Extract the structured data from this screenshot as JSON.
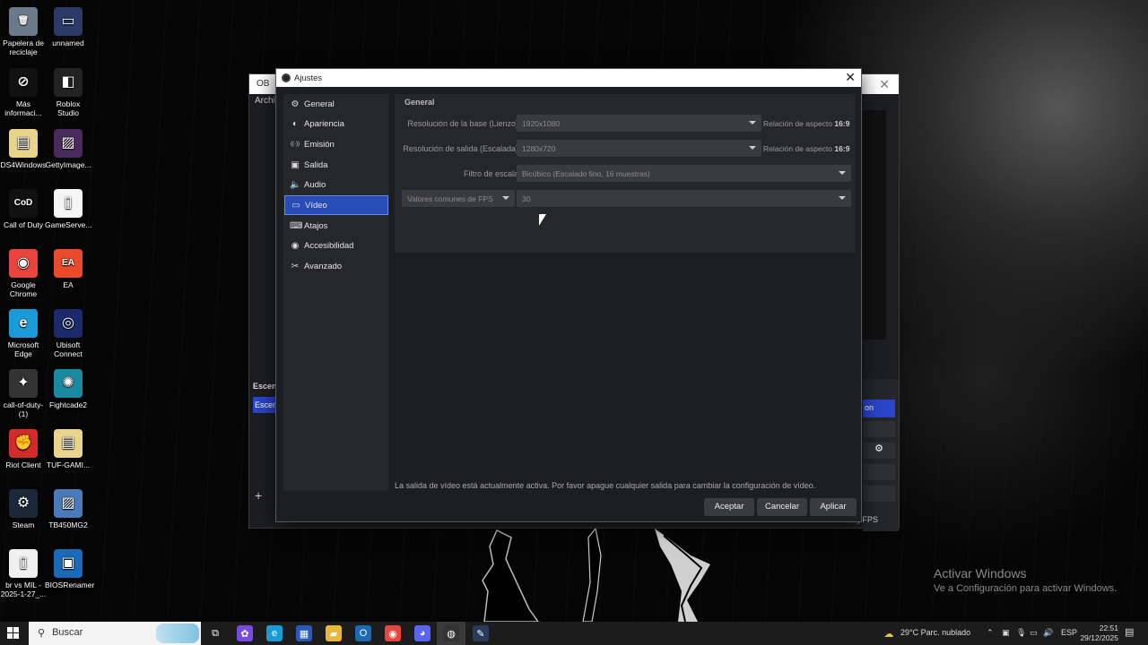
{
  "desktop": {
    "icons": [
      {
        "label": "Papelera de reciclaje",
        "icon": "recycle-bin-icon",
        "color": "#6b7a8a",
        "glyph": "🗑"
      },
      {
        "label": "unnamed",
        "icon": "image-file-icon",
        "color": "#2b3a66",
        "glyph": "▭"
      },
      {
        "label": "Más informaci...",
        "icon": "info-circle-icon",
        "color": "#111111",
        "glyph": "⊘"
      },
      {
        "label": "Roblox Studio",
        "icon": "roblox-studio-icon",
        "color": "#222222",
        "glyph": "◧"
      },
      {
        "label": "DS4Windows",
        "icon": "folder-file-icon",
        "color": "#e8d48a",
        "glyph": "▤"
      },
      {
        "label": "GettyImage...",
        "icon": "image-file-icon",
        "color": "#4a2a5a",
        "glyph": "▨"
      },
      {
        "label": "Call of Duty",
        "icon": "call-of-duty-icon",
        "color": "#111111",
        "glyph": "CoD"
      },
      {
        "label": "GameServe...",
        "icon": "document-file-icon",
        "color": "#f5f5f5",
        "glyph": "▯"
      },
      {
        "label": "Google Chrome",
        "icon": "chrome-icon",
        "color": "#e8453c",
        "glyph": "◉"
      },
      {
        "label": "EA",
        "icon": "ea-icon",
        "color": "#e84a2a",
        "glyph": "EA"
      },
      {
        "label": "Microsoft Edge",
        "icon": "edge-icon",
        "color": "#1a9bd8",
        "glyph": "e"
      },
      {
        "label": "Ubisoft Connect",
        "icon": "ubisoft-icon",
        "color": "#1a2a6a",
        "glyph": "◎"
      },
      {
        "label": "call-of-duty-(1)",
        "icon": "shortcut-icon",
        "color": "#333333",
        "glyph": "✦"
      },
      {
        "label": "Fightcade2",
        "icon": "fightcade-icon",
        "color": "#1a8aa0",
        "glyph": "✺"
      },
      {
        "label": "Riot Client",
        "icon": "riot-client-icon",
        "color": "#d32a2a",
        "glyph": "✊"
      },
      {
        "label": "TUF-GAMI...",
        "icon": "zip-folder-icon",
        "color": "#e8d48a",
        "glyph": "▤"
      },
      {
        "label": "Steam",
        "icon": "steam-icon",
        "color": "#1b2838",
        "glyph": "⚙"
      },
      {
        "label": "TB450MG2",
        "icon": "image-file-icon",
        "color": "#4a7ab8",
        "glyph": "▨"
      },
      {
        "label": "br vs MIL - 2025-1-27_...",
        "icon": "document-file-icon",
        "color": "#f0f0f0",
        "glyph": "▯"
      },
      {
        "label": "BIOSRenamer",
        "icon": "app-window-icon",
        "color": "#1a6ab8",
        "glyph": "▣"
      }
    ],
    "watermark": {
      "title": "Activar Windows",
      "subtitle": "Ve a Configuración para activar Windows."
    }
  },
  "obs_window": {
    "title": "OB",
    "menu_first": "Archiv",
    "scenes_label": "Escen",
    "scene_selected": "Escen",
    "right_blue_label": "on",
    "fps_text": "l) FPS"
  },
  "settings": {
    "title": "Ajustes",
    "sidebar": [
      {
        "label": "General",
        "icon": "gear-icon",
        "glyph": "⚙"
      },
      {
        "label": "Apariencia",
        "icon": "palette-icon",
        "glyph": "◐"
      },
      {
        "label": "Emisión",
        "icon": "broadcast-icon",
        "glyph": "((·))"
      },
      {
        "label": "Salida",
        "icon": "output-icon",
        "glyph": "▣"
      },
      {
        "label": "Audio",
        "icon": "speaker-icon",
        "glyph": "🔈"
      },
      {
        "label": "Vídeo",
        "icon": "monitor-icon",
        "glyph": "▭",
        "active": true
      },
      {
        "label": "Atajos",
        "icon": "keyboard-icon",
        "glyph": "⌨"
      },
      {
        "label": "Accesibilidad",
        "icon": "accessibility-icon",
        "glyph": "◉"
      },
      {
        "label": "Avanzado",
        "icon": "wrench-icon",
        "glyph": "✂"
      }
    ],
    "group_title": "General",
    "base_resolution": {
      "label": "Resolución de la base (Lienzo)",
      "value": "1920x1080",
      "aspect_label": "Relación de aspecto",
      "aspect_value": "16:9"
    },
    "output_resolution": {
      "label": "Resolución de salida (Escalada)",
      "value": "1280x720",
      "aspect_label": "Relación de aspecto",
      "aspect_value": "16:9"
    },
    "scale_filter": {
      "label": "Filtro de escala",
      "value": "Bicúbico (Escalado fino, 16 muestras)"
    },
    "fps": {
      "type_label": "Valores comunes de FPS",
      "value": "30"
    },
    "notice": "La salida de vídeo está actualmente activa. Por favor apague cualquier salida para cambiar la configuración de vídeo.",
    "buttons": {
      "accept": "Aceptar",
      "cancel": "Cancelar",
      "apply": "Aplicar"
    },
    "colors": {
      "accent": "#284cb8",
      "background": "#1d1e21",
      "panel": "#26272b",
      "input": "#3a3b40"
    }
  },
  "taskbar": {
    "search_placeholder": "Buscar",
    "apps": [
      {
        "icon": "task-view-icon",
        "glyph": "⧉",
        "color": "#1c1c1c"
      },
      {
        "icon": "copilot-icon",
        "glyph": "✿",
        "color": "#7a4ae0"
      },
      {
        "icon": "edge-icon",
        "glyph": "e",
        "color": "#1a9bd8"
      },
      {
        "icon": "store-icon",
        "glyph": "▦",
        "color": "#2a5ab8"
      },
      {
        "icon": "file-explorer-icon",
        "glyph": "▰",
        "color": "#e8b83a"
      },
      {
        "icon": "outlook-icon",
        "glyph": "O",
        "color": "#1a6ab8"
      },
      {
        "icon": "chrome-icon",
        "glyph": "◉",
        "color": "#e8453c"
      },
      {
        "icon": "discord-icon",
        "glyph": "◕",
        "color": "#5865f2"
      },
      {
        "icon": "obs-icon",
        "glyph": "◍",
        "color": "#333333",
        "active": true
      },
      {
        "icon": "pen-icon",
        "glyph": "✎",
        "color": "#2a3a5a"
      }
    ],
    "weather": "29°C  Parc. nublado",
    "language": "ESP",
    "time": "22:51",
    "date": "29/12/2025"
  }
}
